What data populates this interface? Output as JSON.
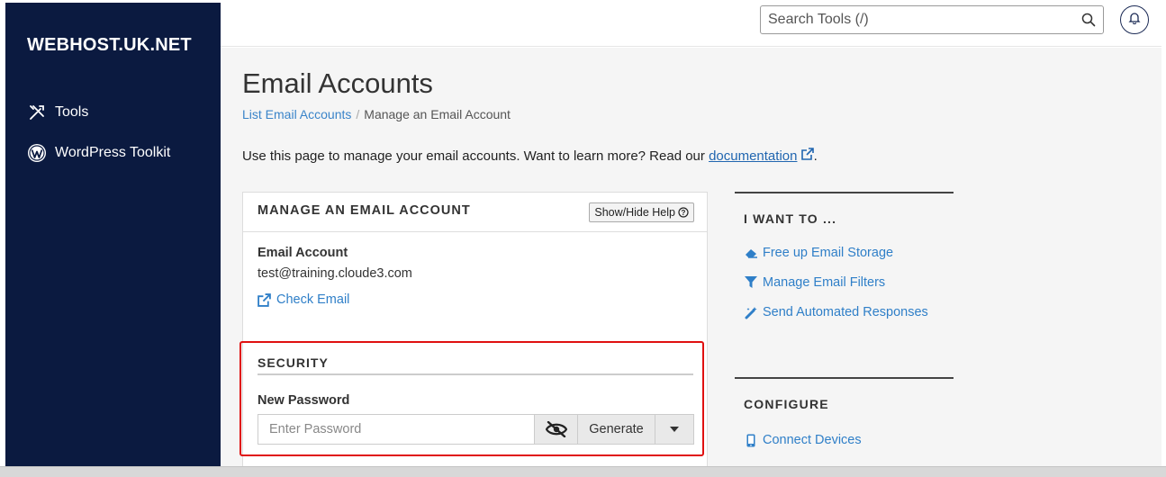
{
  "brand": "WEBHOST.UK.NET",
  "sidebar": {
    "items": [
      {
        "label": "Tools",
        "icon": "tools-icon"
      },
      {
        "label": "WordPress Toolkit",
        "icon": "wordpress-icon"
      }
    ]
  },
  "topbar": {
    "search_placeholder": "Search Tools (/)"
  },
  "page": {
    "title": "Email Accounts",
    "breadcrumb": {
      "link": "List Email Accounts",
      "current": "Manage an Email Account"
    },
    "intro": "Use this page to manage your email accounts. Want to learn more? Read our",
    "intro_link": "documentation",
    "intro_end": "."
  },
  "panel": {
    "title": "MANAGE AN EMAIL ACCOUNT",
    "help_button": "Show/Hide Help",
    "account_label": "Email Account",
    "account_value": "test@training.cloude3.com",
    "check_email": "Check Email",
    "security_title": "SECURITY",
    "password_label": "New Password",
    "password_placeholder": "Enter Password",
    "generate_label": "Generate"
  },
  "side": {
    "want_title": "I WANT TO ...",
    "want_links": [
      {
        "label": "Free up Email Storage",
        "icon": "eraser-icon"
      },
      {
        "label": "Manage Email Filters",
        "icon": "filter-icon"
      },
      {
        "label": "Send Automated Responses",
        "icon": "magic-wand-icon"
      }
    ],
    "configure_title": "CONFIGURE",
    "configure_links": [
      {
        "label": "Connect Devices",
        "icon": "mobile-icon"
      }
    ]
  },
  "colors": {
    "sidebar_bg": "#0b1a40",
    "link": "#2f7fc8",
    "highlight": "#e01010"
  }
}
